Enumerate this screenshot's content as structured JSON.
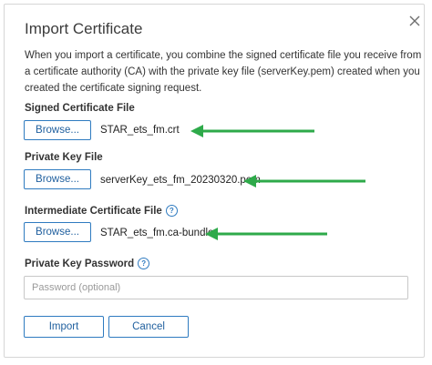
{
  "dialog": {
    "title": "Import Certificate",
    "close_icon": "close-icon",
    "description": "When you import a certificate, you combine the signed certificate file you receive from a certificate authority (CA) with the private key file (serverKey.pem) created when you created the certificate signing request."
  },
  "signed_certificate": {
    "label": "Signed Certificate File",
    "browse_label": "Browse...",
    "file_name": "STAR_ets_fm.crt"
  },
  "private_key": {
    "label": "Private Key File",
    "browse_label": "Browse...",
    "file_name": "serverKey_ets_fm_20230320.pem"
  },
  "intermediate_certificate": {
    "label": "Intermediate Certificate File",
    "help_icon": "help-circle-icon",
    "browse_label": "Browse...",
    "file_name": "STAR_ets_fm.ca-bundle"
  },
  "private_key_password": {
    "label": "Private Key Password",
    "help_icon": "help-circle-icon",
    "value": "",
    "placeholder": "Password (optional)"
  },
  "actions": {
    "import_label": "Import",
    "cancel_label": "Cancel"
  },
  "annotations": {
    "arrow_icon": "left-arrow-icon",
    "arrow_color": "#2eaa4a"
  },
  "colors": {
    "accent": "#2f7bc0",
    "border": "#d6d6d6"
  }
}
